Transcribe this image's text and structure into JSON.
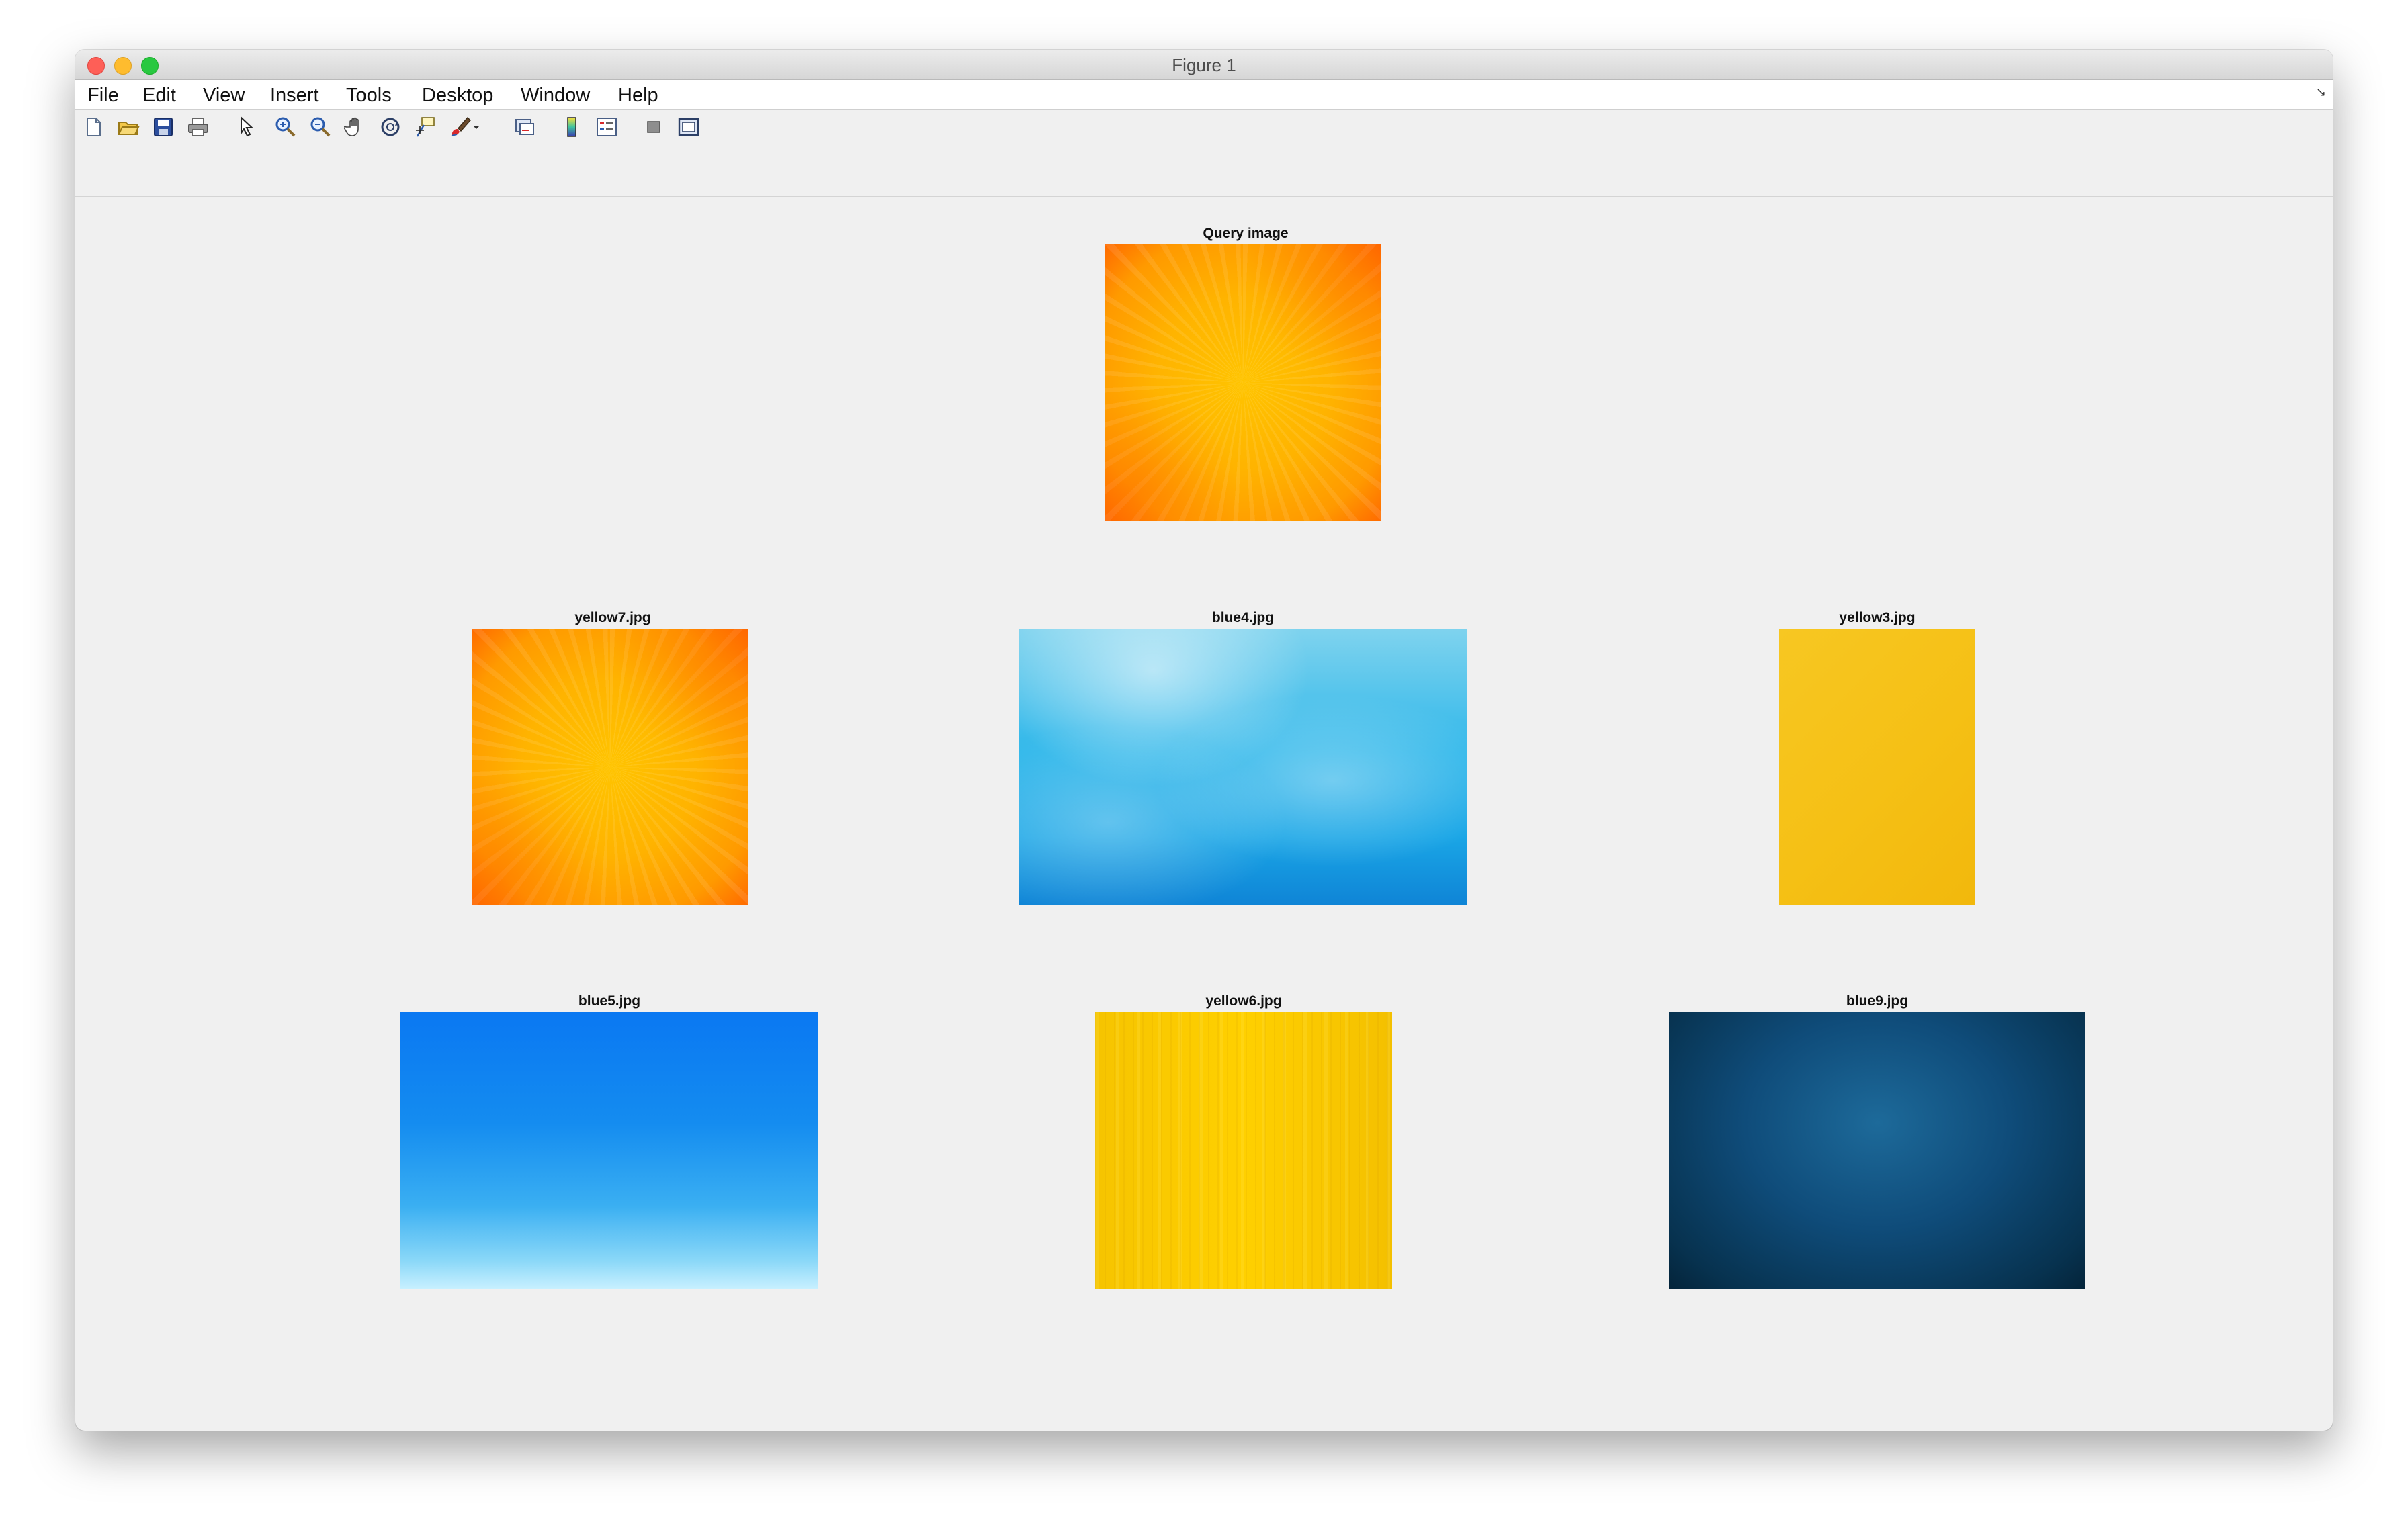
{
  "window": {
    "title": "Figure 1"
  },
  "menubar": {
    "items": [
      "File",
      "Edit",
      "View",
      "Insert",
      "Tools",
      "Desktop",
      "Window",
      "Help"
    ],
    "corner_icon": "undock-arrow-icon"
  },
  "toolbar": {
    "buttons": [
      "new-figure-icon",
      "open-file-icon",
      "save-icon",
      "print-icon",
      "edit-plot-pointer-icon",
      "zoom-in-icon",
      "zoom-out-icon",
      "pan-hand-icon",
      "rotate-3d-icon",
      "data-cursor-icon",
      "brush-icon",
      "link-plot-icon",
      "insert-colorbar-icon",
      "insert-legend-icon",
      "hide-plot-tools-icon",
      "show-plot-tools-icon"
    ]
  },
  "figure": {
    "axes": [
      {
        "title": "Query image",
        "image": "sunburst-yellow-orange"
      },
      {
        "title": "yellow7.jpg",
        "image": "sunburst-yellow-orange"
      },
      {
        "title": "blue4.jpg",
        "image": "water-light-blue"
      },
      {
        "title": "yellow3.jpg",
        "image": "paper-yellow"
      },
      {
        "title": "blue5.jpg",
        "image": "sky-gradient-blue"
      },
      {
        "title": "yellow6.jpg",
        "image": "wood-yellow"
      },
      {
        "title": "blue9.jpg",
        "image": "navy-texture"
      }
    ]
  }
}
